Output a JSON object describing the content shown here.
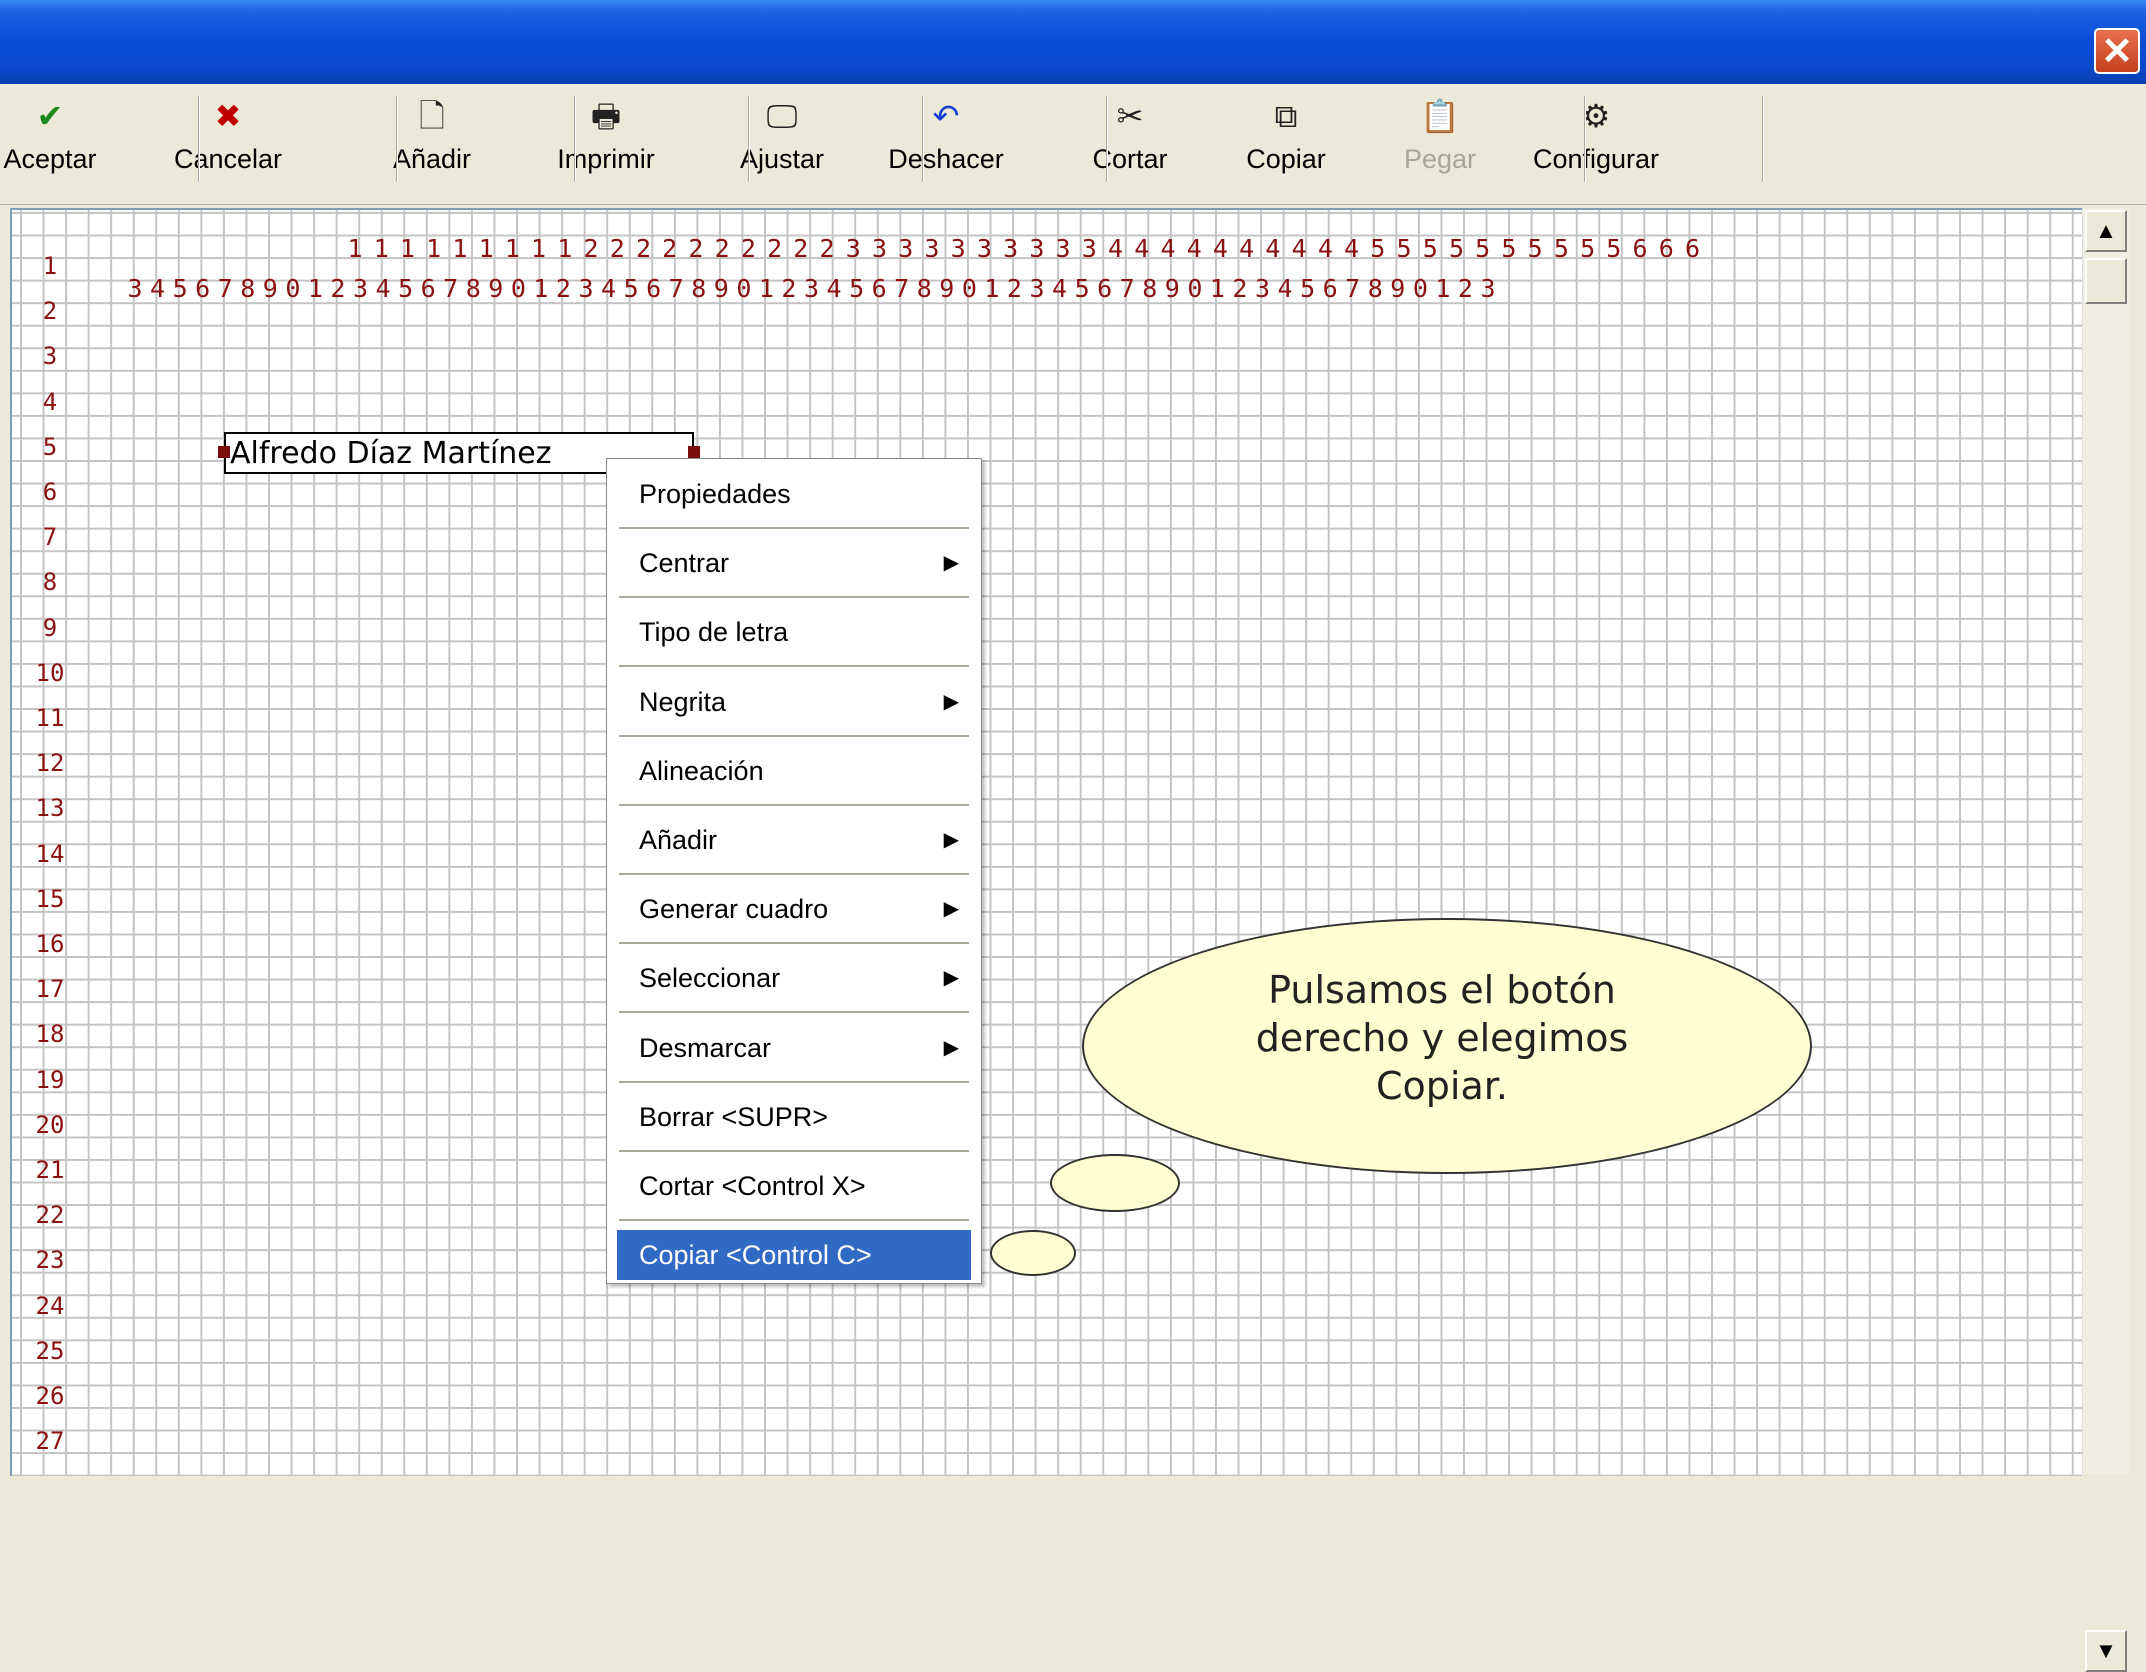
{
  "window": {
    "close_glyph": "✕"
  },
  "toolbar": {
    "buttons": [
      {
        "label": "Aceptar",
        "icon": "check-icon",
        "glyph": "✔",
        "color": "#1a8a1a"
      },
      {
        "label": "Cancelar",
        "icon": "x-icon",
        "glyph": "✖",
        "color": "#c00000"
      },
      {
        "label": "Añadir",
        "icon": "new-page-icon",
        "glyph": "🗋",
        "color": "#222222"
      },
      {
        "label": "Imprimir",
        "icon": "printer-icon",
        "glyph": "🖶",
        "color": "#222222"
      },
      {
        "label": "Ajustar",
        "icon": "monitor-icon",
        "glyph": "🖵",
        "color": "#222222"
      },
      {
        "label": "Deshacer",
        "icon": "undo-icon",
        "glyph": "↶",
        "color": "#1a3fd0"
      },
      {
        "label": "Cortar",
        "icon": "scissors-icon",
        "glyph": "✂",
        "color": "#222222"
      },
      {
        "label": "Copiar",
        "icon": "copy-icon",
        "glyph": "⧉",
        "color": "#222222"
      },
      {
        "label": "Pegar",
        "icon": "paste-icon",
        "glyph": "📋",
        "color": "#a9a696",
        "disabled": true
      },
      {
        "label": "Configurar",
        "icon": "gear-icon",
        "glyph": "⚙",
        "color": "#222222"
      }
    ]
  },
  "ruler": {
    "tens": "1111111111222222222233333333334444444444555555555566 6",
    "top_tens": [
      "1",
      "1",
      "1",
      "1",
      "1",
      "1",
      "1",
      "1",
      "1",
      "2",
      "2",
      "2",
      "2",
      "2",
      "2",
      "2",
      "2",
      "2",
      "2",
      "3",
      "3",
      "3",
      "3",
      "3",
      "3",
      "3",
      "3",
      "3",
      "3",
      "4",
      "4",
      "4",
      "4",
      "4",
      "4",
      "4",
      "4",
      "4",
      "4",
      "5",
      "5",
      "5",
      "5",
      "5",
      "5",
      "5",
      "5",
      "5",
      "5",
      "6",
      "6",
      "6"
    ],
    "units": [
      "3",
      "4",
      "5",
      "6",
      "7",
      "8",
      "9",
      "0",
      "1",
      "2",
      "3",
      "4",
      "5",
      "6",
      "7",
      "8",
      "9",
      "0",
      "1",
      "2",
      "3",
      "4",
      "5",
      "6",
      "7",
      "8",
      "9",
      "0",
      "1",
      "2",
      "3",
      "4",
      "5",
      "6",
      "7",
      "8",
      "9",
      "0",
      "1",
      "2",
      "3",
      "4",
      "5",
      "6",
      "7",
      "8",
      "9",
      "0",
      "1",
      "2",
      "3",
      "4",
      "5",
      "6",
      "7",
      "8",
      "9",
      "0",
      "1",
      "2",
      "3"
    ],
    "rows": [
      "1",
      "2",
      "3",
      "4",
      "5",
      "6",
      "7",
      "8",
      "9",
      "10",
      "11",
      "12",
      "13",
      "14",
      "15",
      "16",
      "17",
      "18",
      "19",
      "20",
      "21",
      "22",
      "23",
      "24",
      "25",
      "26",
      "27"
    ]
  },
  "field": {
    "text": "Alfredo Díaz Martínez"
  },
  "context_menu": {
    "items": [
      {
        "label": "Propiedades",
        "submenu": false
      },
      {
        "label": "Centrar",
        "submenu": true
      },
      {
        "label": "Tipo de letra",
        "submenu": false
      },
      {
        "label": "Negrita",
        "submenu": true
      },
      {
        "label": "Alineación",
        "submenu": false
      },
      {
        "label": "Añadir",
        "submenu": true
      },
      {
        "label": "Generar cuadro",
        "submenu": true
      },
      {
        "label": "Seleccionar",
        "submenu": true
      },
      {
        "label": "Desmarcar",
        "submenu": true
      },
      {
        "label": "Borrar <SUPR>",
        "submenu": false
      },
      {
        "label": "Cortar <Control X>",
        "submenu": false
      },
      {
        "label": "Copiar <Control C>",
        "submenu": false,
        "selected": true
      }
    ],
    "arrow_glyph": "▶"
  },
  "callout": {
    "text_lines": [
      "Pulsamos el botón",
      "derecho y elegimos",
      "Copiar."
    ]
  },
  "scrollbar": {
    "up_glyph": "▲",
    "down_glyph": "▼"
  },
  "colors": {
    "selection": "#316ac5",
    "ruler": "#8b1010",
    "bubble": "#ffffd2",
    "titlebar": "#0a4fd8"
  }
}
